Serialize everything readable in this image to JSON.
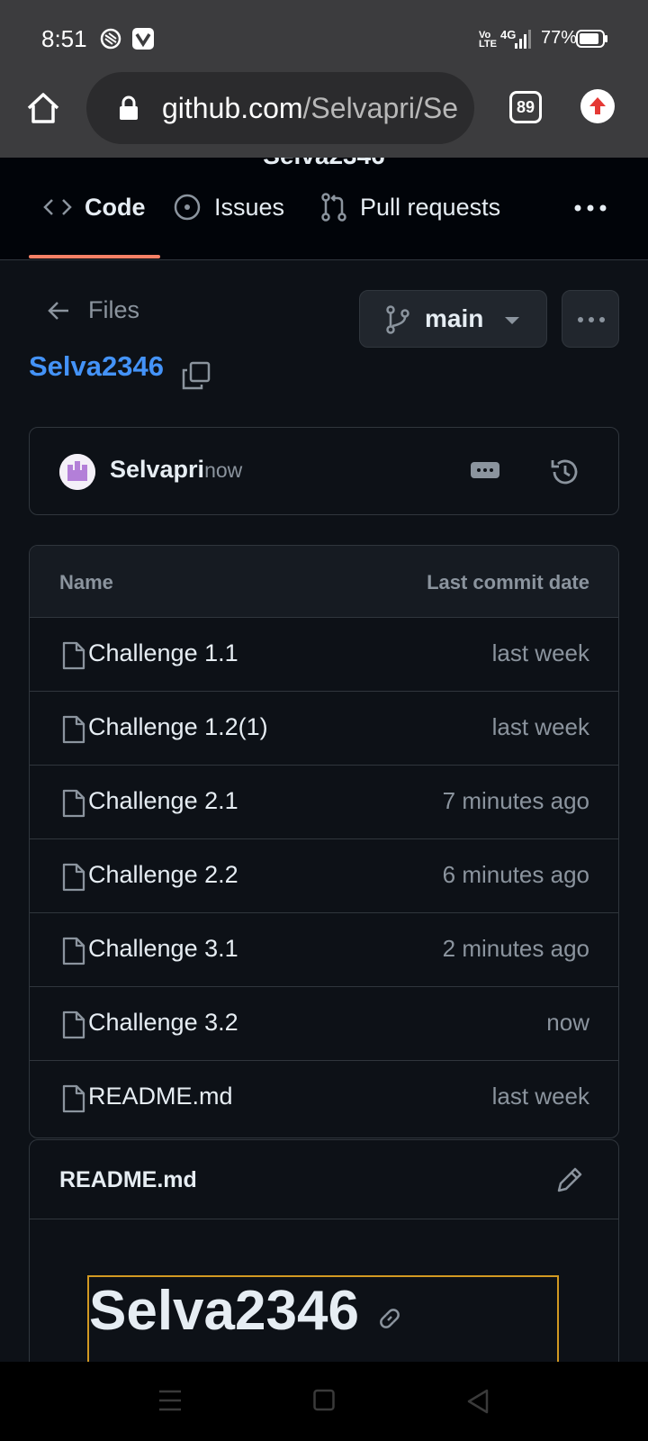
{
  "status_bar": {
    "time": "8:51",
    "battery_percent": "77%",
    "network": "4G",
    "volte": "Vo LTE"
  },
  "browser": {
    "url_host": "github.com",
    "url_path": "/Selvapri/Se",
    "tab_count": "89"
  },
  "github_header": {
    "repo_name_partial": "Selva2346",
    "tabs": [
      {
        "label": "Code",
        "icon": "code-icon",
        "active": true
      },
      {
        "label": "Issues",
        "icon": "issue-circle-icon",
        "active": false
      },
      {
        "label": "Pull requests",
        "icon": "pull-request-icon",
        "active": false
      }
    ],
    "accent_underline_color": "#f78166"
  },
  "file_view": {
    "back_label": "Files",
    "branch": "main",
    "repo_title": "Selva2346",
    "commit": {
      "author": "Selvapri",
      "time": "now"
    },
    "table": {
      "col_name": "Name",
      "col_date": "Last commit date",
      "rows": [
        {
          "name": "Challenge 1.1",
          "date": "last week"
        },
        {
          "name": "Challenge 1.2(1)",
          "date": "last week"
        },
        {
          "name": "Challenge 2.1",
          "date": "7 minutes ago"
        },
        {
          "name": "Challenge 2.2",
          "date": "6 minutes ago"
        },
        {
          "name": "Challenge 3.1",
          "date": "2 minutes ago"
        },
        {
          "name": "Challenge 3.2",
          "date": "now"
        },
        {
          "name": "README.md",
          "date": "last week"
        }
      ]
    },
    "readme": {
      "title": "README.md",
      "heading": "Selva2346"
    }
  },
  "colors": {
    "link_blue": "#4493f8",
    "background": "#0d1117",
    "border": "#30363d",
    "muted_text": "#8b949e"
  }
}
